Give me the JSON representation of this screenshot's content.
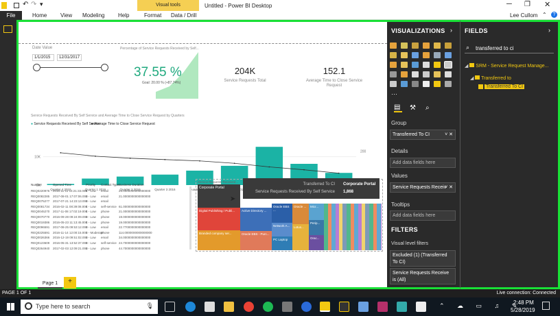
{
  "window": {
    "title": "Untitled - Power BI Desktop",
    "context_tab": "Visual tools",
    "user": "Lee Cullom"
  },
  "ribbon": {
    "tabs": [
      "File",
      "Home",
      "View",
      "Modeling",
      "Help",
      "Format",
      "Data / Drill"
    ]
  },
  "canvas": {
    "slicer": {
      "label": "Date Value",
      "start": "1/1/2015",
      "end": "12/31/2017"
    },
    "gauge": {
      "title": "Percentage of Service Requests Received by Self...",
      "value": "37.55 %",
      "goal": "Goal: 20.00 % (+87.74%)"
    },
    "card1": {
      "value": "204K",
      "label": "Service Requests Total"
    },
    "card2": {
      "value": "152.1",
      "label": "Average Time to Close Service Request"
    },
    "combo_title": "Service Requests Received By Self Service and Average Time to Close Service Request by Quarters",
    "legend": [
      "Service Requests Received By Self Service",
      "Average Time to Close Service Request"
    ],
    "table": {
      "headers": [
        "Number",
        "Opened Time",
        "Priority",
        "Contact Type",
        "Business Duration"
      ],
      "rows": [
        [
          "REQ0220976",
          "2016-11-11 14:21:33.000",
          "4 - Low",
          "email",
          "24.0000000000000000"
        ],
        [
          "REQ0082285",
          "2017-08-01 17:07:06.000",
          "4 - Low",
          "email",
          "21.0000000000000000"
        ],
        [
          "REQ0075277",
          "2017-07-21 14:23:13.000",
          "4 - Low",
          "email",
          ""
        ],
        [
          "REQ0081734",
          "2016-02-11 08:39:08.000",
          "4 - Low",
          "self-service",
          "61.0000000000000000"
        ],
        [
          "REQ0045270",
          "2017-11-08 17:02:19.000",
          "4 - Low",
          "phone",
          "21.0000000000000000"
        ],
        [
          "REQ0070770",
          "2016-09-28 09:24:09.000",
          "4 - Low",
          "phone",
          "19.0000000000000000"
        ],
        [
          "REQ0019386",
          "2016-05-23 11:13:45.000",
          "4 - Low",
          "phone",
          "19.0000000000000000"
        ],
        [
          "REQ0096591",
          "2017-08-25 09:53:12.000",
          "4 - Low",
          "email",
          "22.7700000000000000"
        ],
        [
          "REQ0225591",
          "2016-11-14 12:00:15.000",
          "3 - Moderate",
          "phone",
          "114.0000000000000000"
        ],
        [
          "REQ0026366",
          "2016-12-19 09:51:02.000",
          "4 - Low",
          "email",
          "34.0000000000000000"
        ],
        [
          "REQ0123609",
          "2016-05-31 13:52:37.000",
          "4 - Low",
          "self-service",
          "24.7000000000000000"
        ],
        [
          "REQ0264940",
          "2017-02-03 12:09:21.000",
          "4 - Low",
          "phone",
          "44.7000000000000000"
        ]
      ]
    },
    "treemap": {
      "title": "Service Requests Received...",
      "cells": [
        "Corporate Portal",
        "Digital Publishing / Publi...",
        "Branded company ser...",
        "Active Directory ...",
        "Oracle EBS - Purc...",
        "Oracle EBS ...",
        "Network A...",
        "PC Laptop",
        "Oracle ...",
        "Lotus...",
        "Micr...",
        "Perip...",
        "Orac..."
      ]
    },
    "tooltip": {
      "row1_label": "Transferred To CI",
      "row1_value": "Corporate Portal",
      "row2_label": "Service Requests Received By Self Service",
      "row2_value": "1,868"
    },
    "pages": {
      "page1": "Page 1",
      "add": "+"
    }
  },
  "chart_data": {
    "type": "bar",
    "title": "Service Requests Received By Self Service and Average Time to Close Service Request by Quarters",
    "categories": [
      "Quarter 4 2015",
      "Quarter 1 2016",
      "Quarter 2 2016",
      "Quarter 3 2016",
      "Quarter 4 2016",
      "Quarter 1 2017",
      "Quarter 2 2017",
      "Quarter 3 2017",
      "Quarter 4 2017"
    ],
    "series": [
      {
        "name": "Service Requests Received By Self Service",
        "values": [
          0.4,
          2.3,
          3.0,
          3.7,
          5.1,
          6.8,
          13.5,
          7.5,
          4.3
        ]
      },
      {
        "name": "Average Time to Close Service Request",
        "values": [
          190,
          170,
          158,
          150,
          142,
          128,
          107,
          90,
          70
        ]
      }
    ],
    "y_ticks": [
      "10K",
      "0K"
    ],
    "y2_ticks": [
      "200",
      "0"
    ],
    "ylim": [
      0,
      15
    ],
    "y2lim": [
      0,
      250
    ]
  },
  "viz_pane": {
    "title": "VISUALIZATIONS",
    "group": "Group",
    "group_value": "Transferred To CI",
    "details": "Details",
    "details_placeholder": "Add data fields here",
    "values": "Values",
    "values_value": "Service Requests Receiv",
    "tooltips": "Tooltips",
    "tooltips_placeholder": "Add data fields here",
    "filters": "FILTERS",
    "visual_filters": "Visual level filters",
    "filter1": "Excluded (1) (Transferred To CI)",
    "filter2": "Service Requests Receive is (All)"
  },
  "fields_pane": {
    "title": "FIELDS",
    "search": "transferred to ci",
    "table": "SRM - Service Request Manage...",
    "folder": "Transferred to",
    "field": "Transferred To CI"
  },
  "status": {
    "page": "PAGE 1 OF 1",
    "connection": "Live connection: Connected"
  },
  "taskbar": {
    "search": "Type here to search",
    "time": "2:48 PM",
    "date": "5/28/2019"
  }
}
